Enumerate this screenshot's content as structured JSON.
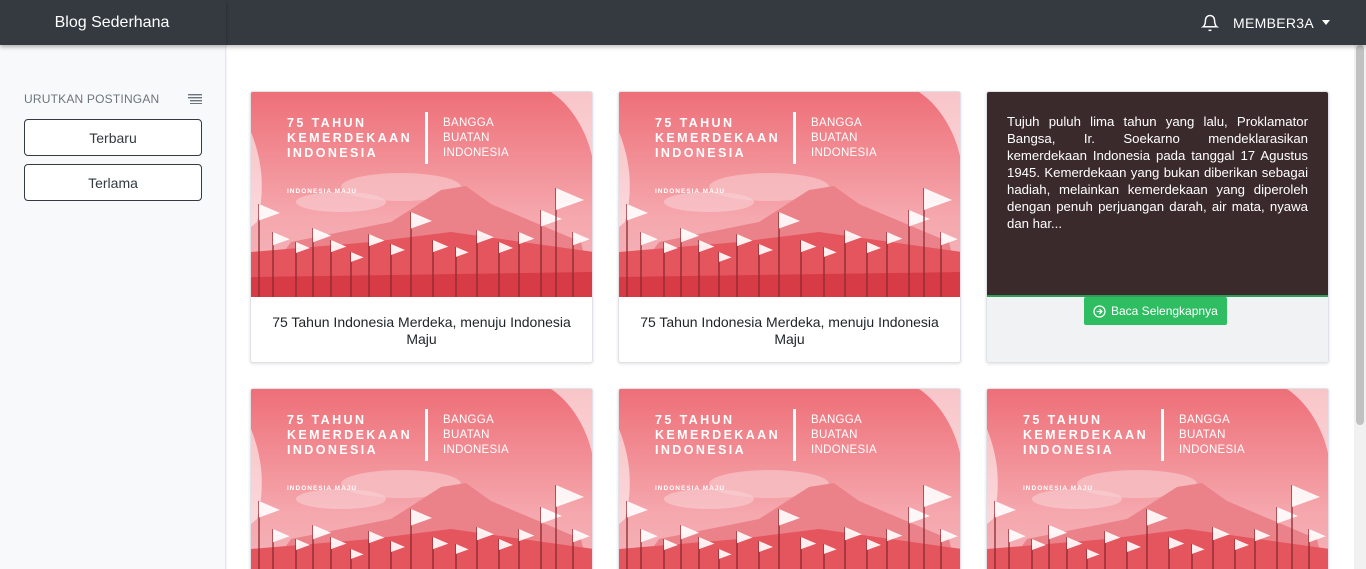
{
  "brand": "Blog Sederhana",
  "topbar": {
    "user": "MEMBER3A"
  },
  "sidebar": {
    "title": "URUTKAN POSTINGAN",
    "buttons": [
      "Terbaru",
      "Terlama"
    ]
  },
  "banner": {
    "left_lines": [
      "75 TAHUN",
      "KEMERDEKAAN",
      "INDONESIA"
    ],
    "right_lines": [
      "BANGGA",
      "BUATAN",
      "INDONESIA"
    ],
    "tag": "INDONESIA MAJU"
  },
  "posts": [
    {
      "title": "75 Tahun Indonesia Merdeka, menuju Indonesia Maju"
    },
    {
      "title": "75 Tahun Indonesia Merdeka, menuju Indonesia Maju"
    },
    {
      "excerpt": "Tujuh puluh lima tahun yang lalu, Proklamator Bangsa, Ir. Soekarno mendeklarasikan kemerdekaan Indonesia pada tanggal 17 Agustus 1945. Kemerdekaan yang bukan diberikan sebagai hadiah, melainkan kemerdekaan yang diperoleh dengan penuh perjuangan darah, air mata, nyawa dan har...",
      "read_more": "Baca Selengkapnya"
    }
  ]
}
